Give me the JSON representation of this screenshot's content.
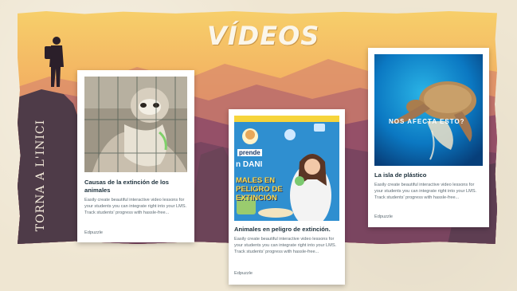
{
  "page": {
    "title": "VÍDEOS",
    "back_link": "TORNA A L'INICI"
  },
  "colors": {
    "sky_top": "#f5c25e",
    "sky_bottom": "#e98a58",
    "mountains": "#8a4e63",
    "cliff": "#4e3b48",
    "card_title": "#1b2f3a"
  },
  "cards": [
    {
      "title": "Causas de la extinción de los animales",
      "description": "Easily create beautiful interactive video lessons for your students you can integrate right into your LMS. Track students' progress with hassle-free...",
      "source": "Edpuzzle",
      "thumbnail": "sloth-behind-fence-photo"
    },
    {
      "title": "Animales en peligro de extinción.",
      "description": "Easily create beautiful interactive video lessons for your students you can integrate right into your LMS. Track students' progress with hassle-free...",
      "source": "Edpuzzle",
      "thumbnail": "aprende-con-dani-thumbnail",
      "thumb_label_top": "prende",
      "thumb_label_mid": "n DANI",
      "thumb_label_bottom": "MALES EN PELIGRO DE EXTINCIÓN"
    },
    {
      "title": "La isla de plástico",
      "description": "Easily create beautiful interactive video lessons for your students you can integrate right into your LMS. Track students' progress with hassle-free...",
      "source": "Edpuzzle",
      "thumbnail": "sea-turtle-photo",
      "thumb_label": "NOS AFECTA ESTO?"
    }
  ]
}
